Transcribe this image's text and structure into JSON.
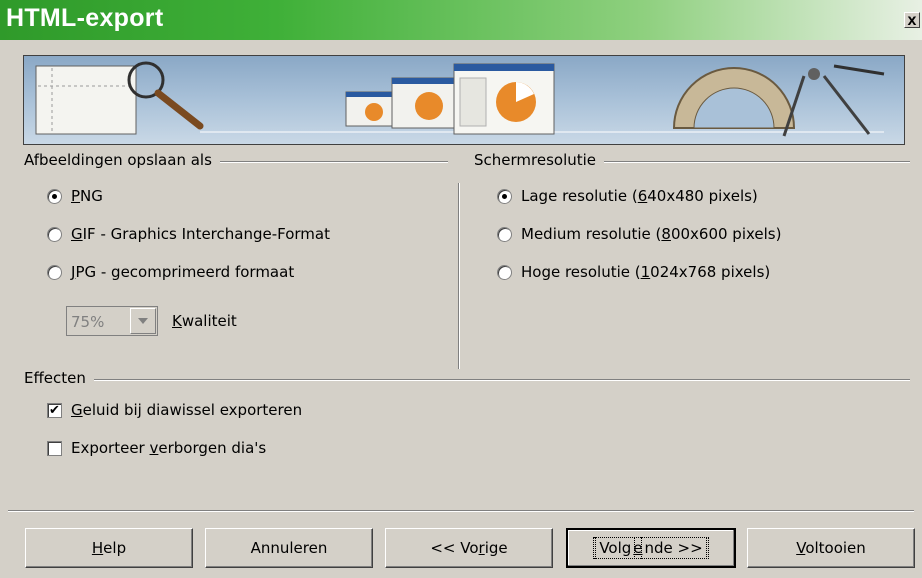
{
  "window": {
    "title": "HTML-export",
    "close_glyph": "x"
  },
  "images": {
    "group_label": "Afbeeldingen opslaan als",
    "options": [
      {
        "label": "PNG",
        "mnemonic": "P",
        "rest": "NG",
        "checked": true
      },
      {
        "label": "GIF - Graphics Interchange-Format",
        "mnemonic": "G",
        "rest": "IF - Graphics Interchange-Format",
        "checked": false
      },
      {
        "label": "JPG - gecomprimeerd formaat",
        "mnemonic": "J",
        "rest": "PG - gecomprimeerd formaat",
        "checked": false
      }
    ],
    "quality_value": "75%",
    "quality_label_mn": "K",
    "quality_label_rest": "waliteit"
  },
  "resolution": {
    "group_label": "Schermresolutie",
    "options": [
      {
        "pre": "Lage resolutie (",
        "mnemonic": "6",
        "post": "40x480 pixels)",
        "checked": true
      },
      {
        "pre": "Medium resolutie (",
        "mnemonic": "8",
        "post": "00x600 pixels)",
        "checked": false
      },
      {
        "pre": "Hoge resolutie (",
        "mnemonic": "1",
        "post": "024x768 pixels)",
        "checked": false
      }
    ]
  },
  "effects": {
    "group_label": "Effecten",
    "options": [
      {
        "pre": "",
        "mnemonic": "G",
        "post": "eluid bij diawissel exporteren",
        "checked": true,
        "check_glyph": "✔"
      },
      {
        "pre": "Exporteer ",
        "mnemonic": "v",
        "post": "erborgen dia's",
        "checked": false,
        "check_glyph": ""
      }
    ]
  },
  "buttons": {
    "help": {
      "mnemonic": "H",
      "rest": "elp"
    },
    "cancel": {
      "label": "Annuleren"
    },
    "back": {
      "pre": "<< Vo",
      "mnemonic": "r",
      "post": "ige"
    },
    "next": {
      "pre": "Volg",
      "mnemonic": "e",
      "post": "nde >>"
    },
    "finish": {
      "mnemonic": "V",
      "rest": "oltooien"
    }
  }
}
